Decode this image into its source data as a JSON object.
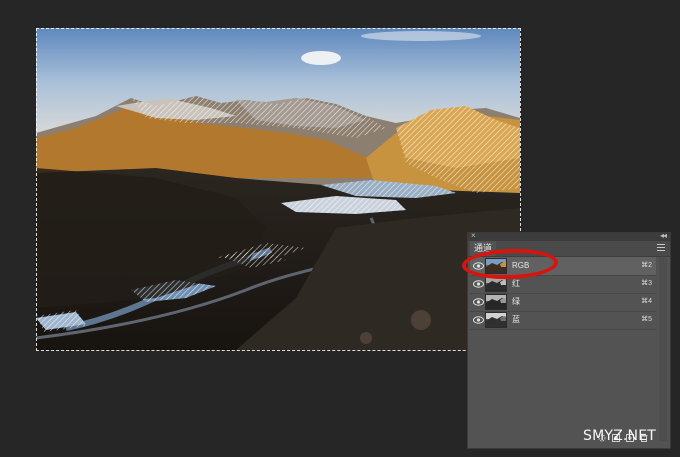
{
  "panel": {
    "tab_label": "通道",
    "close_glyph": "×",
    "collapse_glyph": "◂◂",
    "channels": [
      {
        "name": "RGB",
        "shortcut": "⌘2",
        "visible": true,
        "selected": true
      },
      {
        "name": "红",
        "shortcut": "⌘3",
        "visible": true,
        "selected": false
      },
      {
        "name": "绿",
        "shortcut": "⌘4",
        "visible": true,
        "selected": false
      },
      {
        "name": "蓝",
        "shortcut": "⌘5",
        "visible": true,
        "selected": false
      }
    ],
    "footer_icons": [
      "load-selection-icon",
      "save-selection-icon",
      "new-channel-icon",
      "delete-icon"
    ]
  },
  "document": {
    "content": "mountain valley photo with active marching-ants selection"
  },
  "watermark": "SMYZ.NET",
  "colors": {
    "highlight": "#d8140e",
    "panel_bg": "#535353",
    "workspace_bg": "#262626"
  }
}
